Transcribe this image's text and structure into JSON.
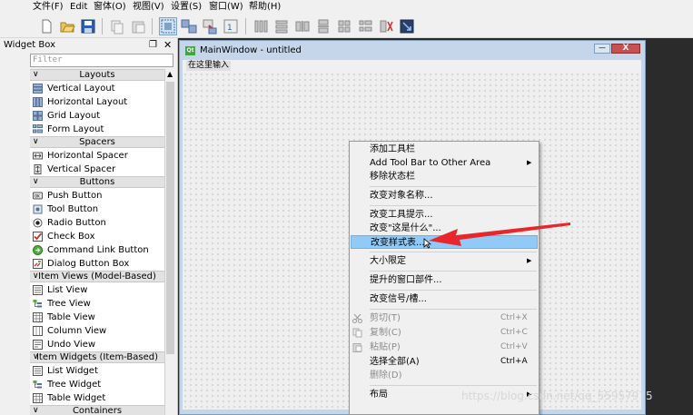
{
  "menubar": {
    "items": [
      "文件(F)",
      "Edit",
      "窗体(O)",
      "视图(V)",
      "设置(S)",
      "窗口(W)",
      "帮助(H)"
    ]
  },
  "toolbar": {
    "buttons": [
      "new-file-icon",
      "open-icon",
      "save-icon",
      "copy-icon",
      "paste-icon",
      "edit-widgets-icon",
      "edit-signals-icon",
      "edit-buddies-icon",
      "edit-tab-order-icon",
      "layout-horizontal-icon",
      "layout-vertical-icon",
      "layout-h-splitter-icon",
      "layout-v-splitter-icon",
      "layout-grid-icon",
      "layout-form-icon",
      "break-layout-icon",
      "adjust-size-icon"
    ]
  },
  "widgetbox": {
    "title": "Widget Box",
    "filter_placeholder": "Filter",
    "categories": [
      {
        "label": "Layouts",
        "items": [
          "Vertical Layout",
          "Horizontal Layout",
          "Grid Layout",
          "Form Layout"
        ]
      },
      {
        "label": "Spacers",
        "items": [
          "Horizontal Spacer",
          "Vertical Spacer"
        ]
      },
      {
        "label": "Buttons",
        "items": [
          "Push Button",
          "Tool Button",
          "Radio Button",
          "Check Box",
          "Command Link Button",
          "Dialog Button Box"
        ]
      },
      {
        "label": "Item Views (Model-Based)",
        "items": [
          "List View",
          "Tree View",
          "Table View",
          "Column View",
          "Undo View"
        ]
      },
      {
        "label": "Item Widgets (Item-Based)",
        "items": [
          "List Widget",
          "Tree Widget",
          "Table Widget"
        ]
      },
      {
        "label": "Containers",
        "items": []
      }
    ]
  },
  "mainwindow": {
    "title": "MainWindow - untitled",
    "menu_placeholder": "在这里输入",
    "icon_text": "Qt",
    "min_glyph": "—",
    "close_glyph": "X"
  },
  "context_menu": {
    "items": [
      {
        "label": "添加工具栏"
      },
      {
        "label": "Add Tool Bar to Other Area",
        "submenu": true
      },
      {
        "label": "移除状态栏"
      },
      {
        "label": "改变对象名称..."
      },
      {
        "label": "改变工具提示..."
      },
      {
        "label": "改变\"这是什么\"..."
      },
      {
        "label": "改变样式表...",
        "highlighted": true
      },
      {
        "label": "大小限定",
        "submenu": true
      },
      {
        "label": "提升的窗口部件..."
      },
      {
        "label": "改变信号/槽..."
      },
      {
        "label": "剪切(T)",
        "shortcut": "Ctrl+X",
        "disabled": true,
        "icon": "cut-icon"
      },
      {
        "label": "复制(C)",
        "shortcut": "Ctrl+C",
        "disabled": true,
        "icon": "copy-icon"
      },
      {
        "label": "粘贴(P)",
        "shortcut": "Ctrl+V",
        "disabled": true,
        "icon": "paste-icon"
      },
      {
        "label": "选择全部(A)",
        "shortcut": "Ctrl+A"
      },
      {
        "label": "删除(D)",
        "disabled": true
      },
      {
        "label": "布局",
        "submenu": true
      }
    ]
  },
  "watermark": "https://blog.csdn.net/qq_55957975",
  "colors": {
    "annotation_arrow": "#e8262b",
    "highlight": "#91c9f7",
    "title_bar": "#c5d6ea"
  }
}
